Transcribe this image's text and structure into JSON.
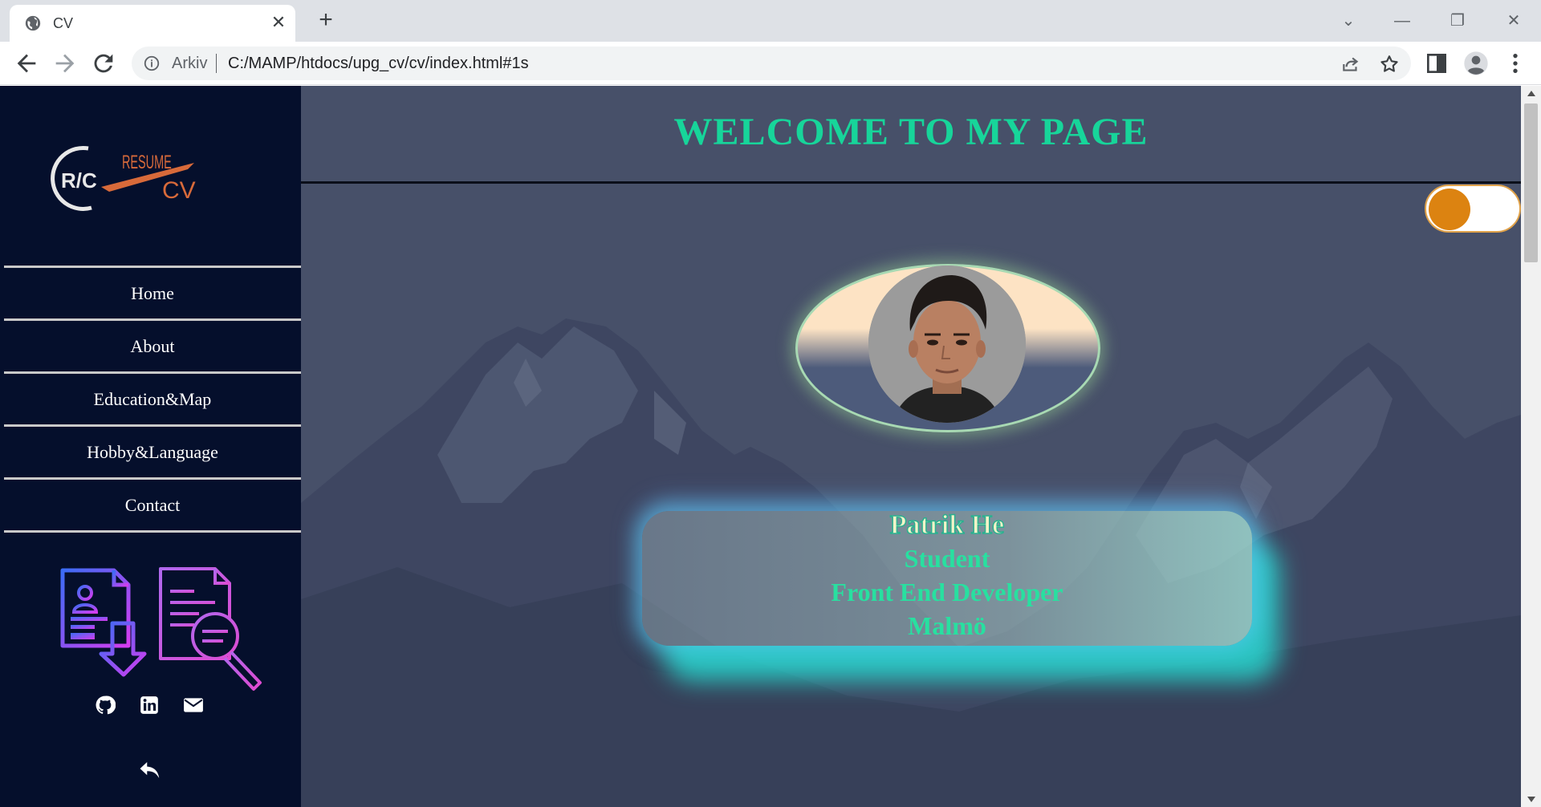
{
  "browser": {
    "tab_title": "CV",
    "url_prefix": "Arkiv",
    "url": "C:/MAMP/htdocs/upg_cv/cv/index.html#1s",
    "tab_icon": "globe-icon"
  },
  "sidebar": {
    "logo_alt": "R/C RESUME CV",
    "logo": {
      "mark": "R/C",
      "word_top": "RESUME",
      "word_bottom": "CV"
    },
    "nav": [
      {
        "label": "Home"
      },
      {
        "label": "About"
      },
      {
        "label": "Education&Map"
      },
      {
        "label": "Hobby&Language"
      },
      {
        "label": "Contact"
      }
    ],
    "social_icons": [
      "github-icon",
      "linkedin-icon",
      "envelope-icon"
    ]
  },
  "main": {
    "title": "WELCOME TO MY PAGE",
    "theme_toggle_on": false,
    "profile": {
      "name": "Patrik He",
      "role": "Student",
      "title": "Front End Developer",
      "city": "Malmö"
    }
  },
  "colors": {
    "sidebar_bg": "#050f2c",
    "title": "#17d59a",
    "toggle_knob": "#dc8311",
    "main_bg": "#475069"
  }
}
